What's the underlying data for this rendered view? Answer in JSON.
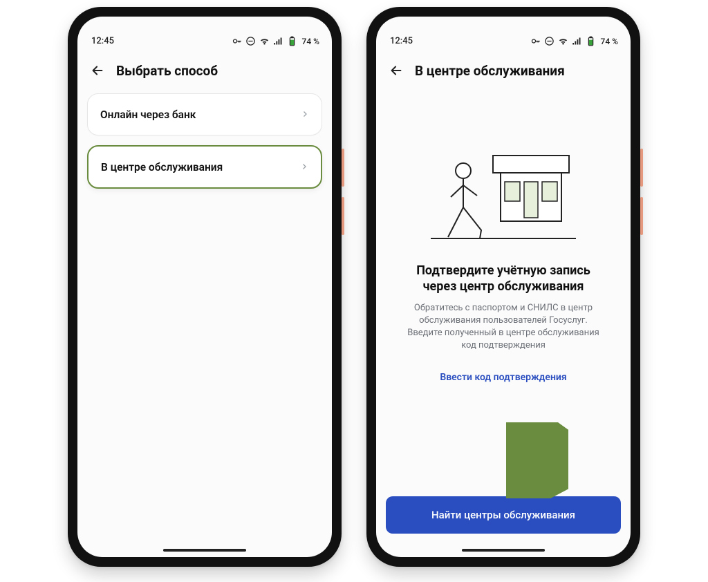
{
  "statusbar": {
    "time": "12:45",
    "battery_pct": "74 %"
  },
  "screen1": {
    "title": "Выбрать способ",
    "options": [
      {
        "label": "Онлайн через банк"
      },
      {
        "label": "В центре обслуживания"
      }
    ]
  },
  "screen2": {
    "title": "В центре обслуживания",
    "message_title": "Подтвердите учётную запись через центр обслуживания",
    "body_line1": "Обратитесь с паспортом и СНИЛС в центр обслуживания пользователей Госуслуг.",
    "body_line2": "Введите полученный в центре обслуживания код подтверждения",
    "link_label": "Ввести код подтверждения",
    "primary_button": "Найти центры обслуживания"
  }
}
